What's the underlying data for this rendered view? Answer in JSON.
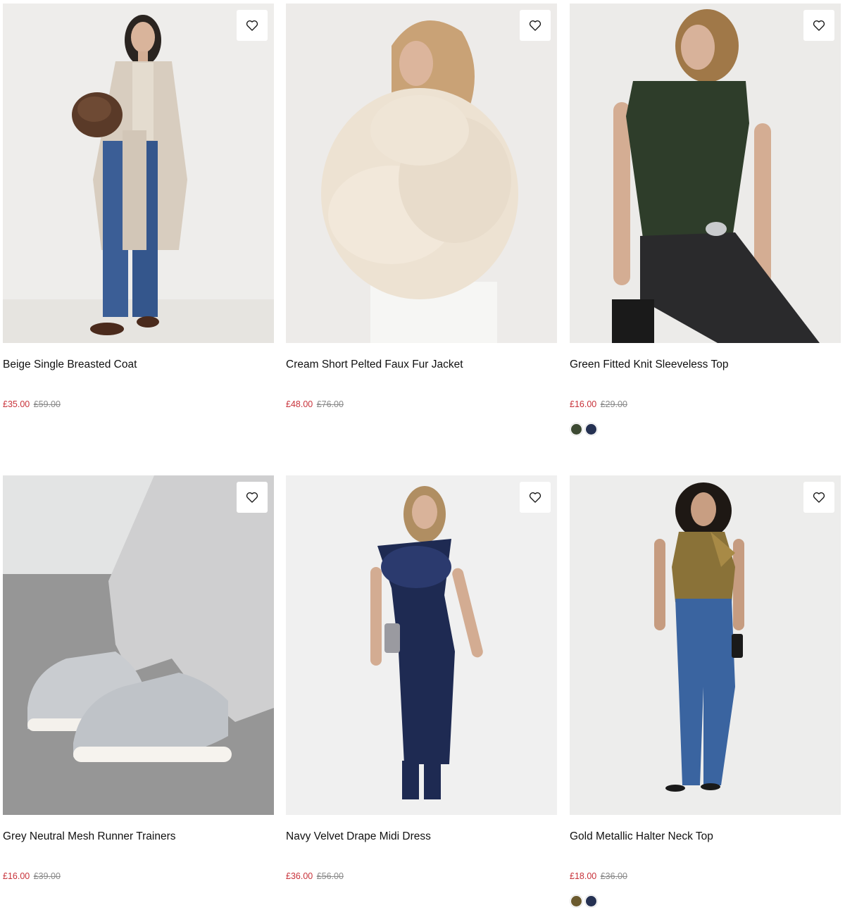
{
  "products": [
    {
      "name": "Beige Single Breasted Coat",
      "sale_price": "£35.00",
      "original_price": "£59.00",
      "image": "woman in beige long coat, blue jeans, brown faux fur bag",
      "swatches": []
    },
    {
      "name": "Cream Short Pelted Faux Fur Jacket",
      "sale_price": "£48.00",
      "original_price": "£76.00",
      "image": "woman in cream fluffy faux fur jacket",
      "swatches": []
    },
    {
      "name": "Green Fitted Knit Sleeveless Top",
      "sale_price": "£16.00",
      "original_price": "£29.00",
      "image": "woman in dark green sleeveless top and black jeans sitting on stool",
      "swatches": [
        {
          "name": "green",
          "color": "#3d4a33"
        },
        {
          "name": "navy",
          "color": "#253152"
        }
      ]
    },
    {
      "name": "Grey Neutral Mesh Runner Trainers",
      "sale_price": "£16.00",
      "original_price": "£39.00",
      "image": "light grey mesh runner trainers with grey joggers",
      "swatches": []
    },
    {
      "name": "Navy Velvet Drape Midi Dress",
      "sale_price": "£36.00",
      "original_price": "£56.00",
      "image": "woman in navy velvet off-shoulder midi dress",
      "swatches": []
    },
    {
      "name": "Gold Metallic Halter Neck Top",
      "sale_price": "£18.00",
      "original_price": "£36.00",
      "image": "woman in gold metallic halter top and blue flared jeans",
      "swatches": [
        {
          "name": "gold",
          "color": "#6b5a2e"
        },
        {
          "name": "navy",
          "color": "#253152"
        }
      ]
    }
  ],
  "colors": {
    "sale": "#c8323a",
    "original": "#8a8a8a",
    "text": "#111111",
    "image_bg": "#ececeb"
  },
  "icons": {
    "wishlist": "heart-outline-icon"
  }
}
